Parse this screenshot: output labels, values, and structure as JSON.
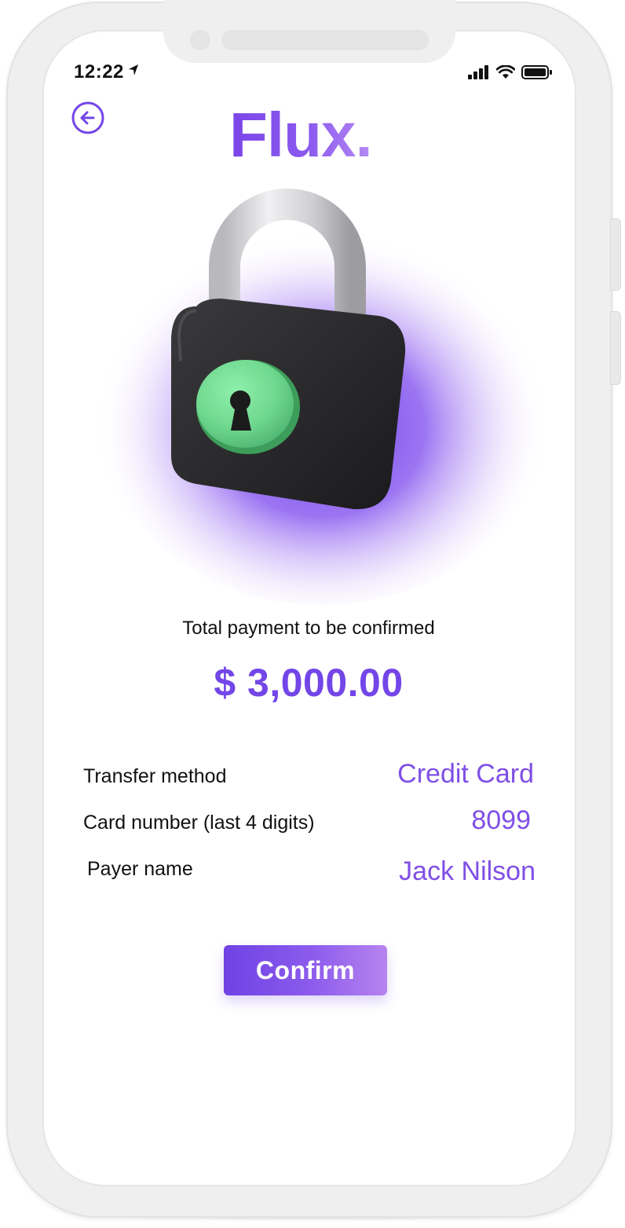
{
  "status_bar": {
    "time": "12:22",
    "location_icon": "location-arrow-icon",
    "signal_icon": "cellular-signal-icon",
    "wifi_icon": "wifi-icon",
    "battery_icon": "battery-icon"
  },
  "header": {
    "back_icon": "arrow-left-circle-icon",
    "brand": "Flux."
  },
  "illustration": {
    "icon": "padlock-icon"
  },
  "payment": {
    "total_label": "Total payment to be confirmed",
    "total_amount": "$ 3,000.00"
  },
  "details": [
    {
      "label": "Transfer  method",
      "value": "Credit Card"
    },
    {
      "label": "Card number (last 4 digits)",
      "value": "8099"
    },
    {
      "label": "Payer name",
      "value": "Jack Nilson"
    }
  ],
  "actions": {
    "confirm_label": "Confirm"
  },
  "colors": {
    "accent": "#7346E8",
    "accent_light": "#B784EF",
    "keyhole_green": "#6FD88F",
    "lock_body": "#2A2A2C"
  }
}
